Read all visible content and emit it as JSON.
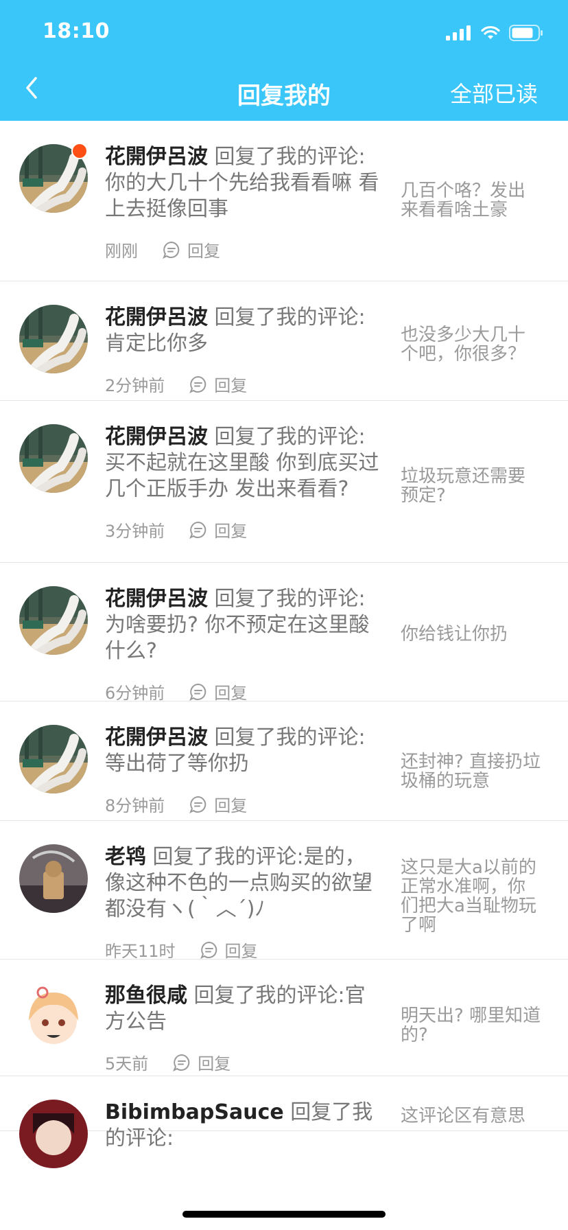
{
  "status_bar": {
    "time": "18:10"
  },
  "nav": {
    "title": "回复我的",
    "mark_all_read": "全部已读"
  },
  "reply_label": "回复",
  "action_text": "回复了我的评论:",
  "items": [
    {
      "name": "花開伊呂波",
      "text": "你的大几十个先给我看看嘛 看上去挺像回事",
      "time": "刚刚",
      "quote": "几百个咯？发出来看看啥土豪",
      "unread": true
    },
    {
      "name": "花開伊呂波",
      "text": "肯定比你多",
      "time": "2分钟前",
      "quote": "也没多少大几十个吧，你很多？",
      "unread": false
    },
    {
      "name": "花開伊呂波",
      "text": "买不起就在这里酸 你到底买过几个正版手办 发出来看看?",
      "time": "3分钟前",
      "quote": "垃圾玩意还需要预定?",
      "unread": false
    },
    {
      "name": "花開伊呂波",
      "text": "为啥要扔? 你不预定在这里酸什么?",
      "time": "6分钟前",
      "quote": "你给钱让你扔",
      "unread": false
    },
    {
      "name": "花開伊呂波",
      "text": "等出荷了等你扔",
      "time": "8分钟前",
      "quote": "还封神? 直接扔垃圾桶的玩意",
      "unread": false
    },
    {
      "name": "老鸨",
      "text": "是的，像这种不色的一点购买的欲望都没有ヽ(｀︿´)ﾉ",
      "time": "昨天11时",
      "quote": "这只是大a以前的正常水准啊，你们把大a当耻物玩了啊",
      "unread": false
    },
    {
      "name": "那鱼很咸",
      "text": "官方公告",
      "time": "5天前",
      "quote": "明天出? 哪里知道的?",
      "unread": false
    },
    {
      "name": "BibimbapSauce",
      "text": "",
      "time": "",
      "quote": "这评论区有意思",
      "unread": false
    }
  ]
}
